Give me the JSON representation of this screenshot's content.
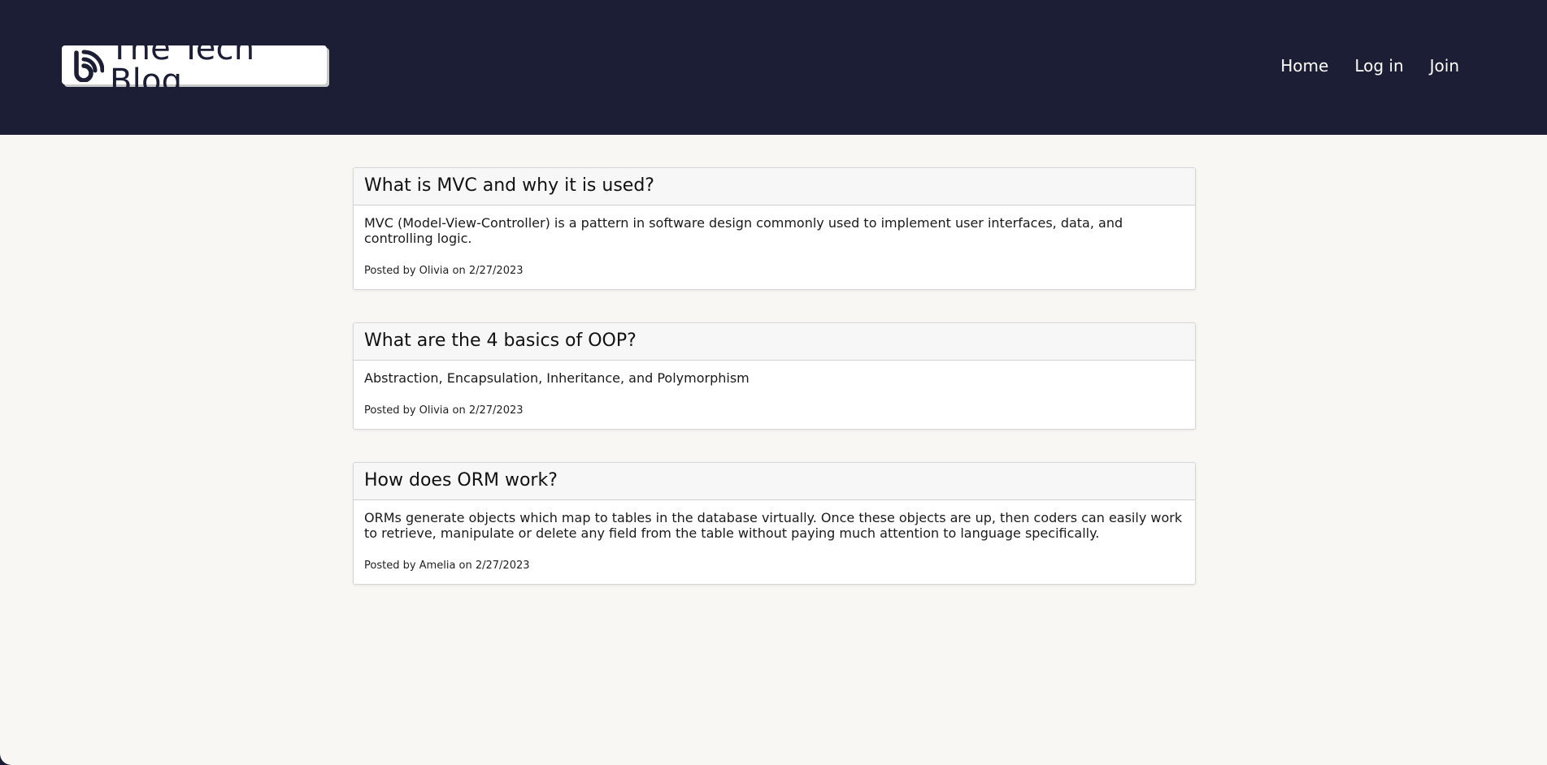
{
  "header": {
    "logo_text": "The Tech Blog",
    "logo_icon": "blog-rss-icon",
    "nav": [
      {
        "label": "Home"
      },
      {
        "label": "Log in"
      },
      {
        "label": "Join"
      }
    ]
  },
  "posts": [
    {
      "title": "What is MVC and why it is used?",
      "content": "MVC (Model-View-Controller) is a pattern in software design commonly used to implement user interfaces, data, and controlling logic.",
      "meta": "Posted by Olivia on 2/27/2023"
    },
    {
      "title": "What are the 4 basics of OOP?",
      "content": "Abstraction, Encapsulation, Inheritance, and Polymorphism",
      "meta": "Posted by Olivia on 2/27/2023"
    },
    {
      "title": "How does ORM work?",
      "content": "ORMs generate objects which map to tables in the database virtually. Once these objects are up, then coders can easily work to retrieve, manipulate or delete any field from the table without paying much attention to language specifically.",
      "meta": "Posted by Amelia on 2/27/2023"
    }
  ],
  "colors": {
    "header_bg": "#1b1e34",
    "page_bg": "#f8f7f4",
    "card_header_bg": "#f7f7f7",
    "nav_text": "#ffffff"
  }
}
